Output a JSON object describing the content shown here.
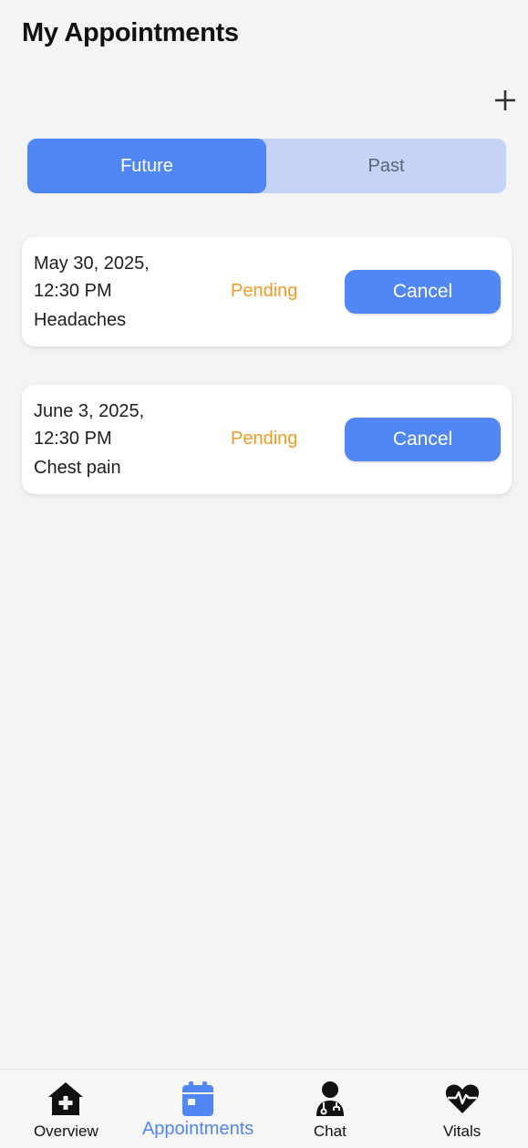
{
  "header": {
    "title": "My Appointments",
    "add_icon": "plus-icon"
  },
  "tabs": [
    {
      "label": "Future",
      "active": true
    },
    {
      "label": "Past",
      "active": false
    }
  ],
  "appointments": [
    {
      "date": "May 30, 2025,",
      "time": "12:30 PM",
      "reason": "Headaches",
      "status": "Pending",
      "action": "Cancel"
    },
    {
      "date": "June 3, 2025,",
      "time": "12:30 PM",
      "reason": "Chest pain",
      "status": "Pending",
      "action": "Cancel"
    }
  ],
  "bottom_nav": [
    {
      "label": "Overview",
      "icon": "home-medical-icon",
      "active": false
    },
    {
      "label": "Appointments",
      "icon": "calendar-icon",
      "active": true
    },
    {
      "label": "Chat",
      "icon": "doctor-icon",
      "active": false
    },
    {
      "label": "Vitals",
      "icon": "heartbeat-icon",
      "active": false
    }
  ],
  "colors": {
    "accent": "#5186f5",
    "tab_track": "#c4d3f6",
    "pending": "#f39a23",
    "background": "#f4f4f4"
  }
}
